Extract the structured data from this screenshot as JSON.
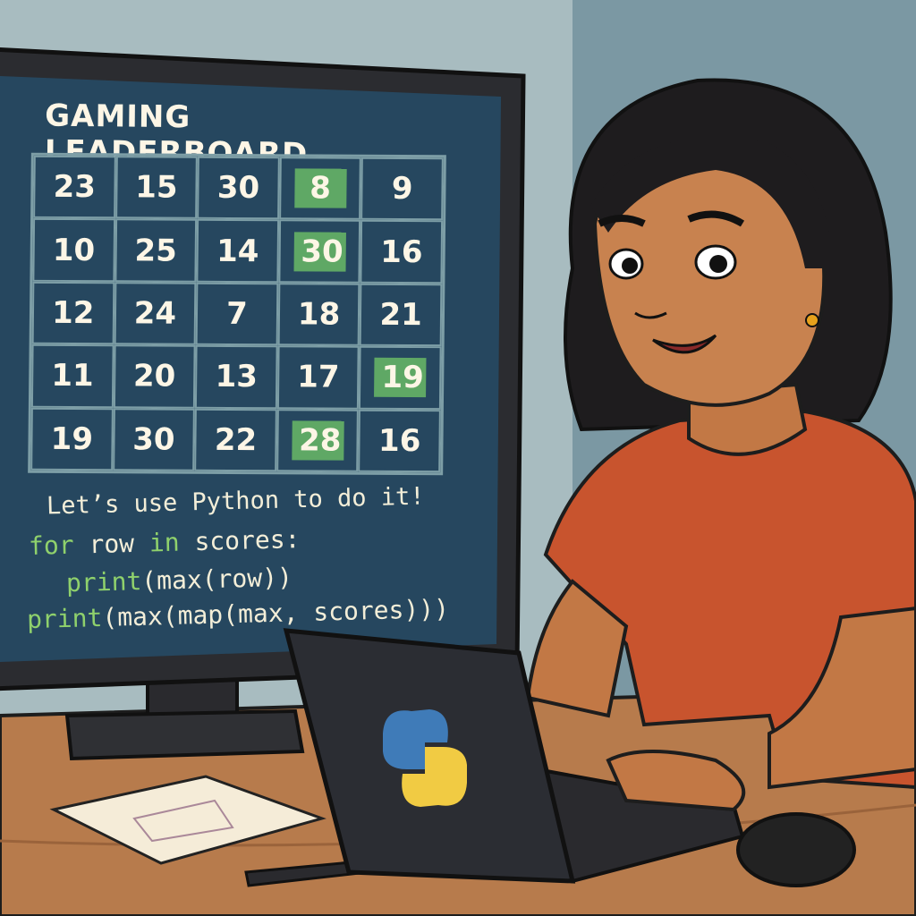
{
  "screen": {
    "title": "GAMING LEADERBOARD",
    "grid": [
      [
        {
          "v": "23"
        },
        {
          "v": "15"
        },
        {
          "v": "30"
        },
        {
          "v": "8",
          "highlight": true
        },
        {
          "v": "9"
        }
      ],
      [
        {
          "v": "10"
        },
        {
          "v": "25"
        },
        {
          "v": "14"
        },
        {
          "v": "30",
          "highlight": true
        },
        {
          "v": "16"
        }
      ],
      [
        {
          "v": "12"
        },
        {
          "v": "24"
        },
        {
          "v": "7"
        },
        {
          "v": "18"
        },
        {
          "v": "21"
        }
      ],
      [
        {
          "v": "11"
        },
        {
          "v": "20"
        },
        {
          "v": "13"
        },
        {
          "v": "17"
        },
        {
          "v": "19",
          "highlight": true
        }
      ],
      [
        {
          "v": "19"
        },
        {
          "v": "30"
        },
        {
          "v": "22"
        },
        {
          "v": "28",
          "highlight": true
        },
        {
          "v": "16"
        }
      ]
    ],
    "caption": "Let’s use Python to do it!",
    "code": {
      "line1": {
        "kw1": "for",
        "t1": " row ",
        "kw2": "in",
        "t2": " scores:"
      },
      "line2": {
        "kw": "print",
        "t": "(max(row))"
      },
      "line3": {
        "kw": "print",
        "t": "(max(map(max, scores)))"
      }
    }
  },
  "laptop_logo": "python-logo",
  "colors": {
    "screen_bg": "#26475f",
    "highlight": "#5fa865",
    "keyword": "#8fd16c",
    "shirt": "#c8542e",
    "wall": "#8fa9b2",
    "desk": "#b77b4c"
  }
}
